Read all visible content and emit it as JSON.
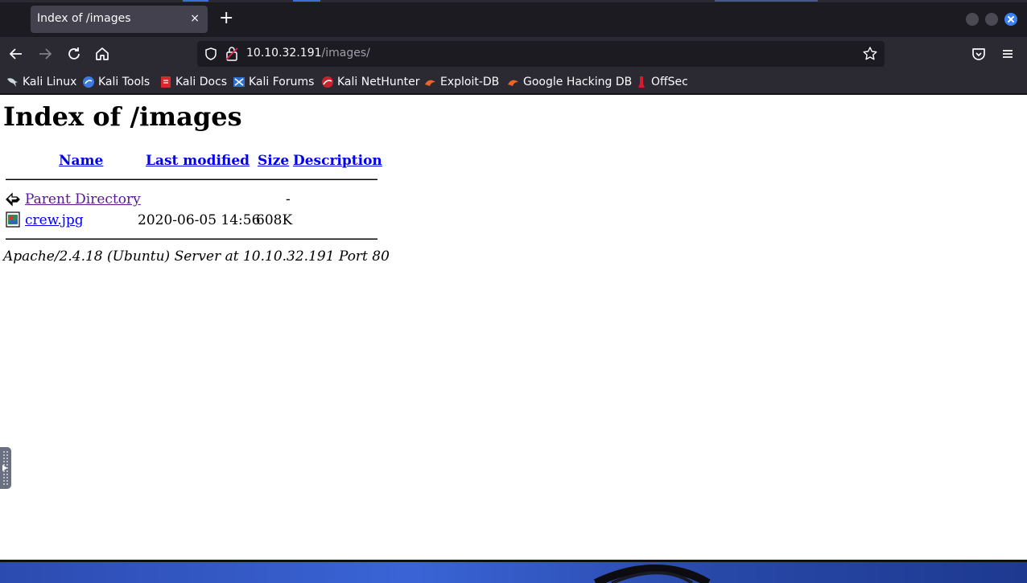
{
  "browser": {
    "tab_title": "Index of /images",
    "tab_close": "×",
    "new_tab": "+",
    "url_host": "10.10.32.191",
    "url_path": "/images/"
  },
  "bookmarks": [
    {
      "label": "Kali Linux",
      "icon": "kali-dragon-icon"
    },
    {
      "label": "Kali Tools",
      "icon": "kali-tools-icon"
    },
    {
      "label": "Kali Docs",
      "icon": "kali-docs-icon"
    },
    {
      "label": "Kali Forums",
      "icon": "kali-forums-icon"
    },
    {
      "label": "Kali NetHunter",
      "icon": "nethunter-icon"
    },
    {
      "label": "Exploit-DB",
      "icon": "exploit-db-icon"
    },
    {
      "label": "Google Hacking DB",
      "icon": "ghdb-icon"
    },
    {
      "label": "OffSec",
      "icon": "offsec-icon"
    }
  ],
  "page": {
    "title": "Index of /images",
    "columns": {
      "name": "Name",
      "last_modified": "Last modified",
      "size": "Size",
      "description": "Description"
    },
    "rows": [
      {
        "name": "Parent Directory",
        "modified": "",
        "size": "-",
        "description": "",
        "icon": "back-arrow-icon"
      },
      {
        "name": "crew.jpg",
        "modified": "2020-06-05 14:56",
        "size": "608K",
        "description": "",
        "icon": "image-file-icon"
      }
    ],
    "footer": "Apache/2.4.18 (Ubuntu) Server at 10.10.32.191 Port 80"
  },
  "colors": {
    "link": "#0000ee",
    "visited_link": "#551a8b",
    "chrome_dark": "#1c1b22",
    "toolbar": "#2b2a33",
    "accent": "#3b82f6"
  }
}
